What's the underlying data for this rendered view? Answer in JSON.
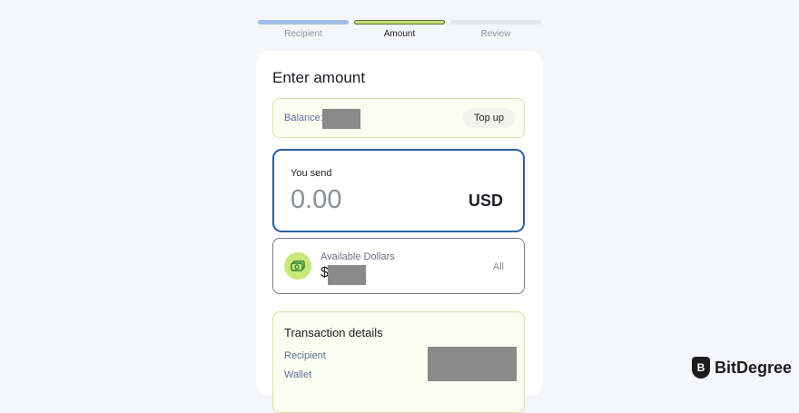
{
  "stepper": {
    "steps": [
      {
        "label": "Recipient"
      },
      {
        "label": "Amount"
      },
      {
        "label": "Review"
      }
    ]
  },
  "card": {
    "title": "Enter amount",
    "balance": {
      "label": "Balance:",
      "topup_label": "Top up"
    },
    "send": {
      "label": "You send",
      "amount": "0.00",
      "currency": "USD"
    },
    "available": {
      "label": "Available Dollars",
      "symbol": "$",
      "all_label": "All",
      "icon": "money-icon"
    },
    "transaction": {
      "title": "Transaction details",
      "rows": [
        "Recipient",
        "Wallet"
      ]
    }
  },
  "watermark": {
    "brand": "BitDegree"
  }
}
